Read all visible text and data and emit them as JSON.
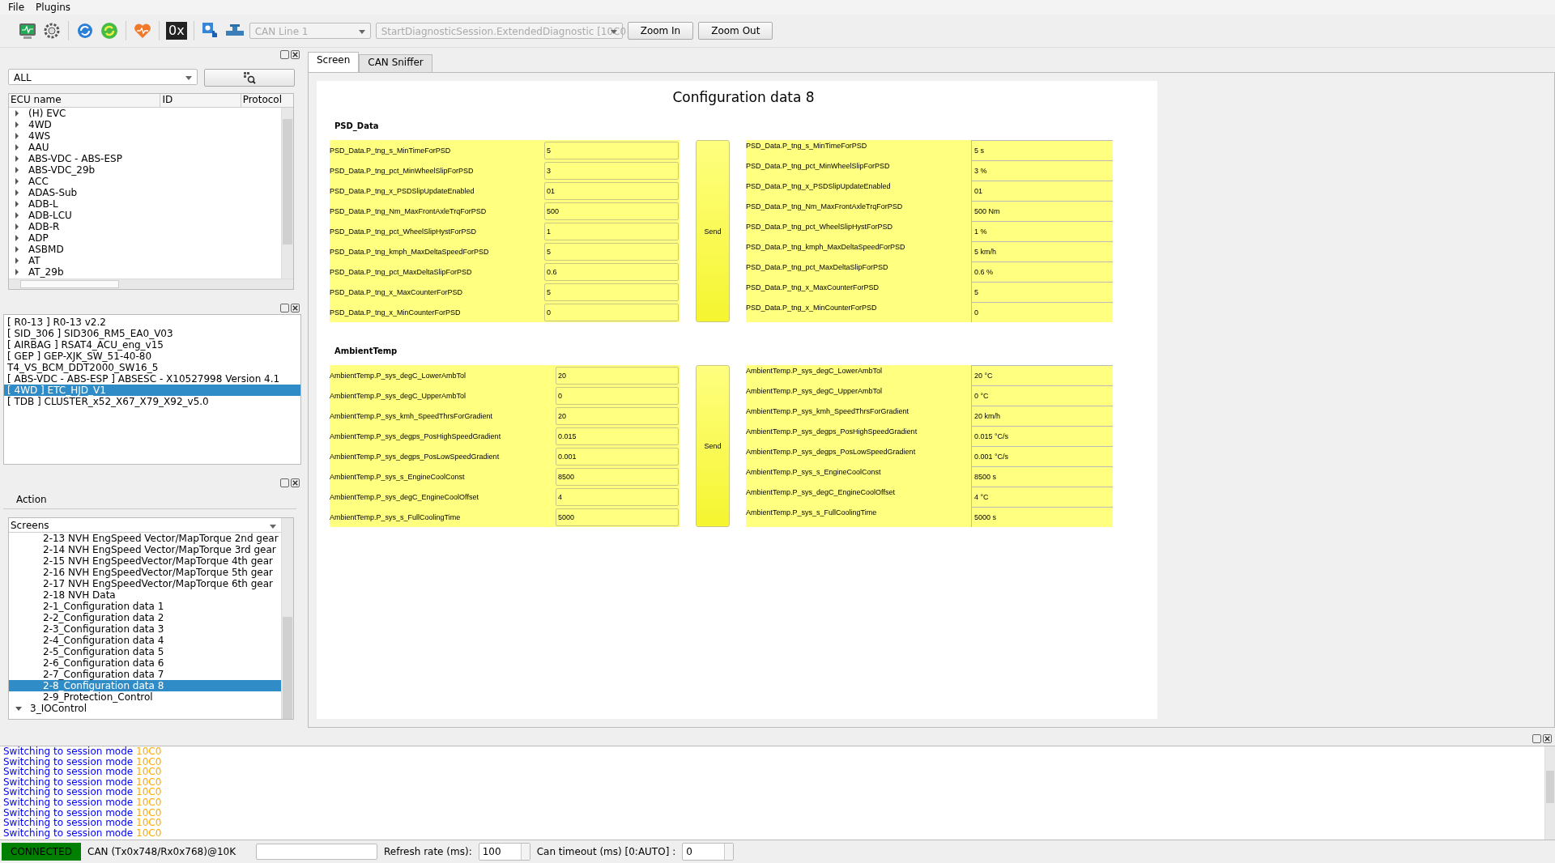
{
  "menu": [
    "File",
    "Plugins"
  ],
  "toolbar": {
    "hex_label": "0x",
    "combos": [
      {
        "value": "CAN Line 1",
        "disabled": true
      },
      {
        "value": "StartDiagnosticSession.ExtendedDiagnostic [10C0",
        "disabled": true
      }
    ],
    "buttons": [
      "Zoom In",
      "Zoom Out"
    ]
  },
  "ecu_filter": {
    "value": "ALL"
  },
  "ecu_table": {
    "columns": [
      "ECU name",
      "ID",
      "Protocol"
    ],
    "rows": [
      "(H) EVC",
      "4WD",
      "4WS",
      "AAU",
      "ABS-VDC - ABS-ESP",
      "ABS-VDC_29b",
      "ACC",
      "ADAS-Sub",
      "ADB-L",
      "ADB-LCU",
      "ADB-R",
      "ADP",
      "ASBMD",
      "AT",
      "AT_29b"
    ]
  },
  "ecu_list": [
    {
      "text": "[ R0-13 ] R0-13 v2.2",
      "selected": false
    },
    {
      "text": "[ SID_306 ] SID306_RM5_EA0_V03",
      "selected": false
    },
    {
      "text": "[ AIRBAG ] RSAT4_ACU_eng_v15",
      "selected": false
    },
    {
      "text": "[ GEP ] GEP-XJK_SW_51-40-80",
      "selected": false
    },
    {
      "text": "T4_VS_BCM_DDT2000_SW16_5",
      "selected": false
    },
    {
      "text": "[ ABS-VDC - ABS-ESP ] ABSESC - X10527998 Version 4.1",
      "selected": false
    },
    {
      "text": "[ 4WD ] ETC_HJD_V1",
      "selected": true
    },
    {
      "text": "[ TDB ] CLUSTER_x52_X67_X79_X92_v5.0",
      "selected": false
    }
  ],
  "action": {
    "title": "Action",
    "combo": "Screens",
    "tree": [
      {
        "children": [
          {
            "label": "2-13 NVH EngSpeed Vector/MapTorque 2nd gear",
            "selected": false
          },
          {
            "label": "2-14 NVH EngSpeed Vector/MapTorque 3rd gear",
            "selected": false
          },
          {
            "label": "2-15 NVH EngSpeedVector/MapTorque 4th gear",
            "selected": false
          },
          {
            "label": "2-16 NVH EngSpeedVector/MapTorque 5th gear",
            "selected": false
          },
          {
            "label": "2-17 NVH EngSpeedVector/MapTorque 6th gear",
            "selected": false
          },
          {
            "label": "2-18 NVH Data",
            "selected": false
          },
          {
            "label": "2-1_Configuration data 1",
            "selected": false
          },
          {
            "label": "2-2_Configuration data 2",
            "selected": false
          },
          {
            "label": "2-3_Configuration data 3",
            "selected": false
          },
          {
            "label": "2-4_Configuration data 4",
            "selected": false
          },
          {
            "label": "2-5_Configuration data 5",
            "selected": false
          },
          {
            "label": "2-6_Configuration data 6",
            "selected": false
          },
          {
            "label": "2-7_Configuration data 7",
            "selected": false
          },
          {
            "label": "2-8_Configuration data 8",
            "selected": true
          },
          {
            "label": "2-9_Protection_Control",
            "selected": false
          }
        ]
      },
      {
        "label": "3_IOControl",
        "expanded": true,
        "selected": false
      }
    ]
  },
  "tabs": [
    {
      "label": "Screen",
      "selected": true
    },
    {
      "label": "CAN Sniffer",
      "selected": false
    }
  ],
  "screen": {
    "title": "Configuration data 8",
    "sections": [
      {
        "title": "PSD_Data",
        "send": "Send",
        "inputs": [
          {
            "name": "PSD_Data.P_tng_s_MinTimeForPSD",
            "value": "5"
          },
          {
            "name": "PSD_Data.P_tng_pct_MinWheelSlipForPSD",
            "value": "3"
          },
          {
            "name": "PSD_Data.P_tng_x_PSDSlipUpdateEnabled",
            "value": "01"
          },
          {
            "name": "PSD_Data.P_tng_Nm_MaxFrontAxleTrqForPSD",
            "value": "500"
          },
          {
            "name": "PSD_Data.P_tng_pct_WheelSlipHystForPSD",
            "value": "1"
          },
          {
            "name": "PSD_Data.P_tng_kmph_MaxDeltaSpeedForPSD",
            "value": "5"
          },
          {
            "name": "PSD_Data.P_tng_pct_MaxDeltaSlipForPSD",
            "value": "0.6"
          },
          {
            "name": "PSD_Data.P_tng_x_MaxCounterForPSD",
            "value": "5"
          },
          {
            "name": "PSD_Data.P_tng_x_MinCounterForPSD",
            "value": "0"
          }
        ],
        "readings": [
          {
            "name": "PSD_Data.P_tng_s_MinTimeForPSD",
            "value": "5 s"
          },
          {
            "name": "PSD_Data.P_tng_pct_MinWheelSlipForPSD",
            "value": "3 %"
          },
          {
            "name": "PSD_Data.P_tng_x_PSDSlipUpdateEnabled",
            "value": "01"
          },
          {
            "name": "PSD_Data.P_tng_Nm_MaxFrontAxleTrqForPSD",
            "value": "500 Nm"
          },
          {
            "name": "PSD_Data.P_tng_pct_WheelSlipHystForPSD",
            "value": "1 %"
          },
          {
            "name": "PSD_Data.P_tng_kmph_MaxDeltaSpeedForPSD",
            "value": "5 km/h"
          },
          {
            "name": "PSD_Data.P_tng_pct_MaxDeltaSlipForPSD",
            "value": "0.6 %"
          },
          {
            "name": "PSD_Data.P_tng_x_MaxCounterForPSD",
            "value": "5"
          },
          {
            "name": "PSD_Data.P_tng_x_MinCounterForPSD",
            "value": "0"
          }
        ]
      },
      {
        "title": "AmbientTemp",
        "send": "Send",
        "inputs": [
          {
            "name": "AmbientTemp.P_sys_degC_LowerAmbTol",
            "value": "20"
          },
          {
            "name": "AmbientTemp.P_sys_degC_UpperAmbTol",
            "value": "0"
          },
          {
            "name": "AmbientTemp.P_sys_kmh_SpeedThrsForGradient",
            "value": "20"
          },
          {
            "name": "AmbientTemp.P_sys_degps_PosHighSpeedGradient",
            "value": "0.015"
          },
          {
            "name": "AmbientTemp.P_sys_degps_PosLowSpeedGradient",
            "value": "0.001"
          },
          {
            "name": "AmbientTemp.P_sys_s_EngineCoolConst",
            "value": "8500"
          },
          {
            "name": "AmbientTemp.P_sys_degC_EngineCoolOffset",
            "value": "4"
          },
          {
            "name": "AmbientTemp.P_sys_s_FullCoolingTime",
            "value": "5000"
          }
        ],
        "readings": [
          {
            "name": "AmbientTemp.P_sys_degC_LowerAmbTol",
            "value": "20 °C"
          },
          {
            "name": "AmbientTemp.P_sys_degC_UpperAmbTol",
            "value": "0 °C"
          },
          {
            "name": "AmbientTemp.P_sys_kmh_SpeedThrsForGradient",
            "value": "20 km/h"
          },
          {
            "name": "AmbientTemp.P_sys_degps_PosHighSpeedGradient",
            "value": "0.015 °C/s"
          },
          {
            "name": "AmbientTemp.P_sys_degps_PosLowSpeedGradient",
            "value": "0.001 °C/s"
          },
          {
            "name": "AmbientTemp.P_sys_s_EngineCoolConst",
            "value": "8500 s"
          },
          {
            "name": "AmbientTemp.P_sys_degC_EngineCoolOffset",
            "value": "4 °C"
          },
          {
            "name": "AmbientTemp.P_sys_s_FullCoolingTime",
            "value": "5000 s"
          }
        ]
      }
    ]
  },
  "log": [
    {
      "text": "Switching to session mode",
      "code": "10C0"
    },
    {
      "text": "Switching to session mode",
      "code": "10C0"
    },
    {
      "text": "Switching to session mode",
      "code": "10C0"
    },
    {
      "text": "Switching to session mode",
      "code": "10C0"
    },
    {
      "text": "Switching to session mode",
      "code": "10C0"
    },
    {
      "text": "Switching to session mode",
      "code": "10C0"
    },
    {
      "text": "Switching to session mode",
      "code": "10C0"
    },
    {
      "text": "Switching to session mode",
      "code": "10C0"
    },
    {
      "text": "Switching to session mode",
      "code": "10C0"
    }
  ],
  "status_bar": {
    "connection": "CONNECTED",
    "connected": true,
    "bus_info": "CAN (Tx0x748/Rx0x768)@10K",
    "refresh_label": "Refresh rate (ms):",
    "refresh_value": "100",
    "timeout_label": "Can timeout (ms) [0:AUTO] :",
    "timeout_value": "0"
  }
}
